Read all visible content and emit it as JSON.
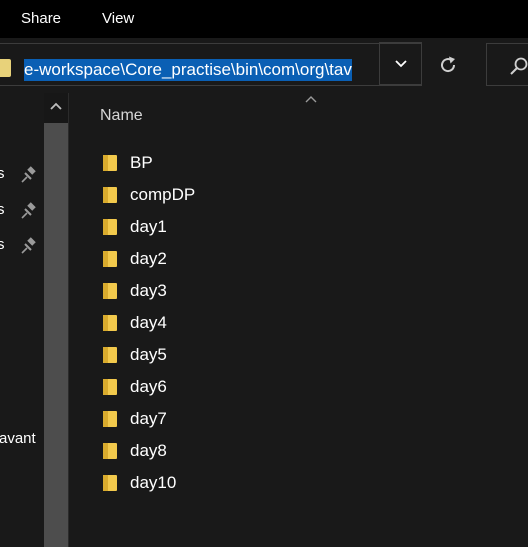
{
  "ribbon": {
    "tabs": [
      {
        "label": "Share"
      },
      {
        "label": "View"
      }
    ]
  },
  "address_bar": {
    "path": "e-workspace\\Core_practise\\bin\\com\\org\\tav"
  },
  "nav_pane": {
    "partial_items": [
      {
        "label": "s"
      },
      {
        "label": "s"
      },
      {
        "label": "s"
      },
      {
        "label": "avant"
      }
    ]
  },
  "file_list": {
    "column_header": "Name",
    "items": [
      {
        "name": "BP"
      },
      {
        "name": "compDP"
      },
      {
        "name": "day1"
      },
      {
        "name": "day2"
      },
      {
        "name": "day3"
      },
      {
        "name": "day4"
      },
      {
        "name": "day5"
      },
      {
        "name": "day6"
      },
      {
        "name": "day7"
      },
      {
        "name": "day8"
      },
      {
        "name": "day10"
      }
    ]
  },
  "colors": {
    "selection": "#0a5fb4",
    "folder": "#f2c94c",
    "background": "#191919"
  }
}
